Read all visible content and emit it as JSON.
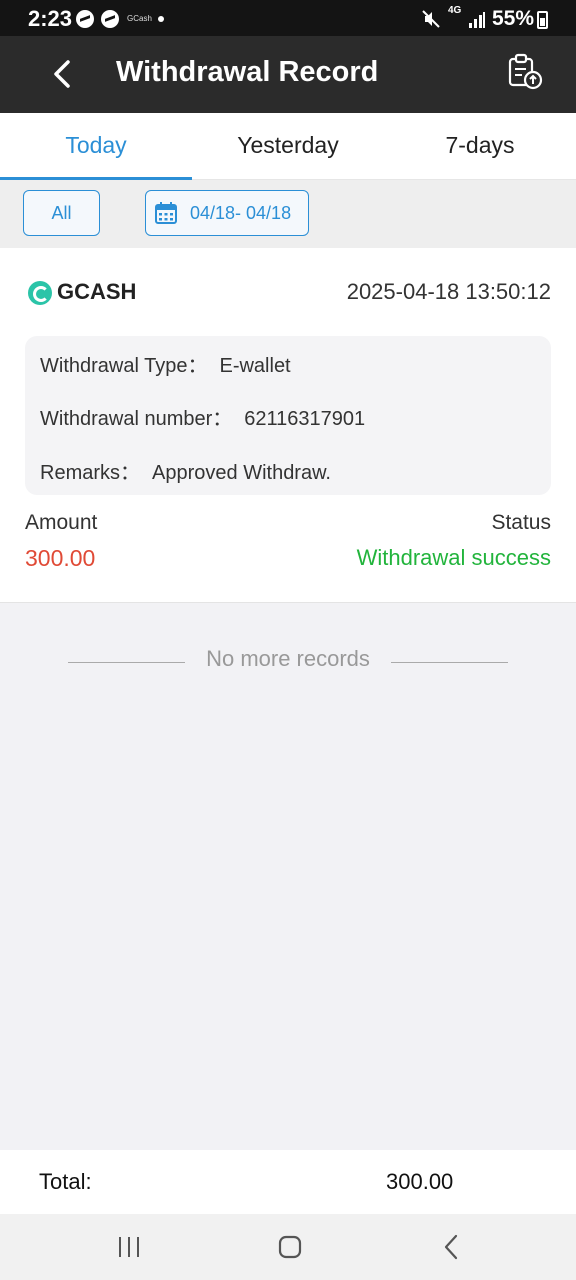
{
  "status_bar": {
    "time": "2:23",
    "app_label": "GCash",
    "network": "4G",
    "battery": "55%"
  },
  "header": {
    "title": "Withdrawal Record",
    "back_icon": "back-arrow-icon",
    "export_icon": "clipboard-upload-icon"
  },
  "tabs": [
    {
      "label": "Today",
      "active": true
    },
    {
      "label": "Yesterday",
      "active": false
    },
    {
      "label": "7-days",
      "active": false
    }
  ],
  "filters": {
    "all_label": "All",
    "date_range": "04/18- 04/18"
  },
  "record": {
    "method": "GCASH",
    "datetime": "2025-04-18 13:50:12",
    "details": [
      {
        "key": "Withdrawal Type：",
        "value": "E-wallet"
      },
      {
        "key": "Withdrawal number：",
        "value": "62116317901"
      },
      {
        "key": "Remarks：",
        "value": "Approved Withdraw."
      }
    ],
    "amount_label": "Amount",
    "amount": "300.00",
    "status_label": "Status",
    "status": "Withdrawal success"
  },
  "footer_note": "No more records",
  "total": {
    "label": "Total:",
    "value": "300.00"
  },
  "colors": {
    "accent": "#2b8fd6",
    "amount": "#e04a36",
    "success": "#22b43c",
    "header_bg": "#2b2b2b"
  }
}
